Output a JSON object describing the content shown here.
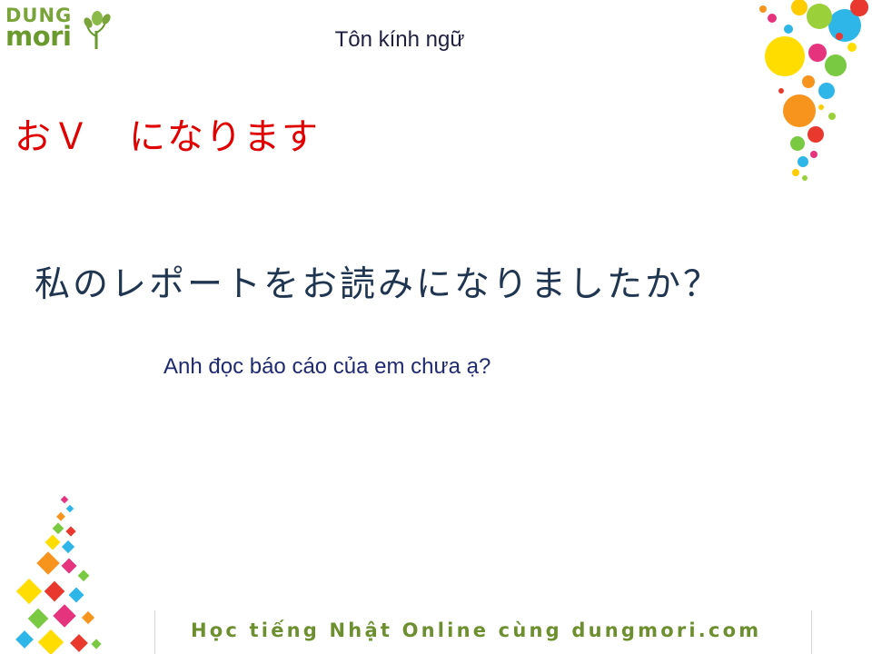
{
  "logo": {
    "line1": "DUNG",
    "line2": "mori"
  },
  "slide": {
    "title": "Tôn kính ngữ",
    "grammar_pattern": "おＶ　になります",
    "example_jp": "私のレポートをお読みになりましたか？",
    "example_vi": "Anh đọc báo cáo của em chưa ạ?"
  },
  "footer": {
    "text": "Học tiếng Nhật Online cùng dungmori.com"
  },
  "colors": {
    "brand_green": "#6d8f2f",
    "grammar_red": "#e00000",
    "title_dark": "#1f1f3f",
    "sentence_navy": "#1f3550"
  }
}
